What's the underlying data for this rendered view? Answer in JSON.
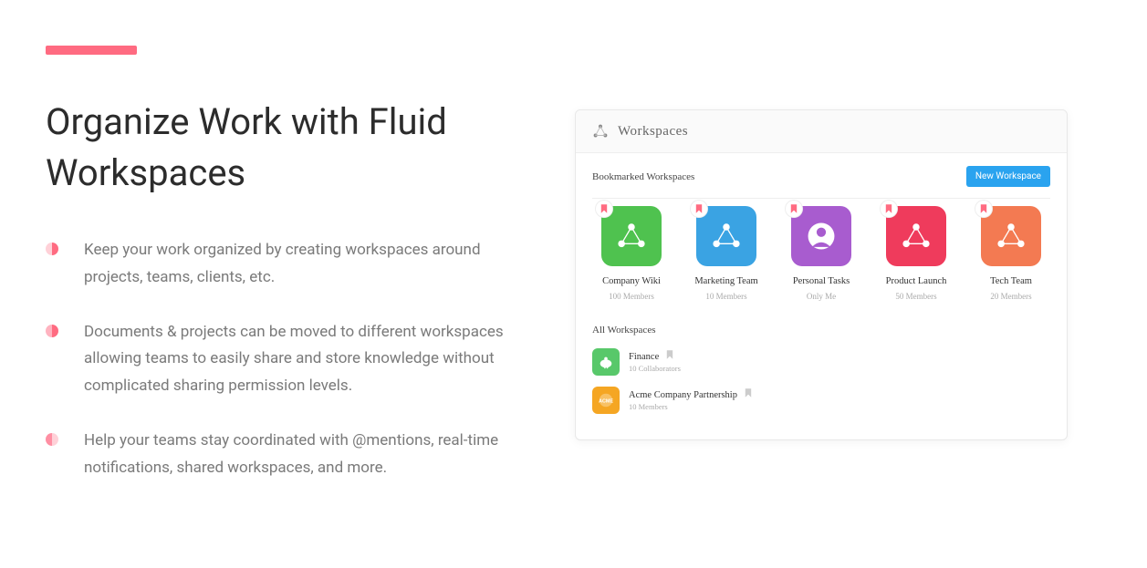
{
  "accentColor": "#ff6b81",
  "headline": "Organize Work with Fluid Workspaces",
  "bullets": [
    "Keep your work organized by creating workspaces around projects, teams, clients, etc.",
    "Documents & projects can be moved to different workspaces allowing teams to easily share and store knowledge without complicated sharing permission levels.",
    "Help your teams stay coordinated with @mentions, real-time notifications, shared workspaces, and more."
  ],
  "panel": {
    "title": "Workspaces",
    "bookmarkedLabel": "Bookmarked   Workspaces",
    "newWorkspaceBtn": "New Workspace",
    "tiles": [
      {
        "name": "Company Wiki",
        "meta": "100 Members",
        "bg": "#4fc24f",
        "icon": "nodes"
      },
      {
        "name": "Marketing  Team",
        "meta": "10 Members",
        "bg": "#3aa3e3",
        "icon": "nodes"
      },
      {
        "name": "Personal  Tasks",
        "meta": "Only Me",
        "bg": "#a85ccf",
        "icon": "avatar"
      },
      {
        "name": "Product Launch",
        "meta": "50 Members",
        "bg": "#ef3b5c",
        "icon": "nodes"
      },
      {
        "name": "Tech  Team",
        "meta": "20 Members",
        "bg": "#f37a52",
        "icon": "nodes"
      }
    ],
    "allLabel": "All Workspaces",
    "list": [
      {
        "name": "Finance",
        "meta": "10 Collaborators",
        "bg": "#58c86a",
        "icon": "piggy"
      },
      {
        "name": "Acme Company Partnership",
        "meta": "10 Members",
        "bg": "#f5a623",
        "icon": "acme"
      }
    ]
  }
}
